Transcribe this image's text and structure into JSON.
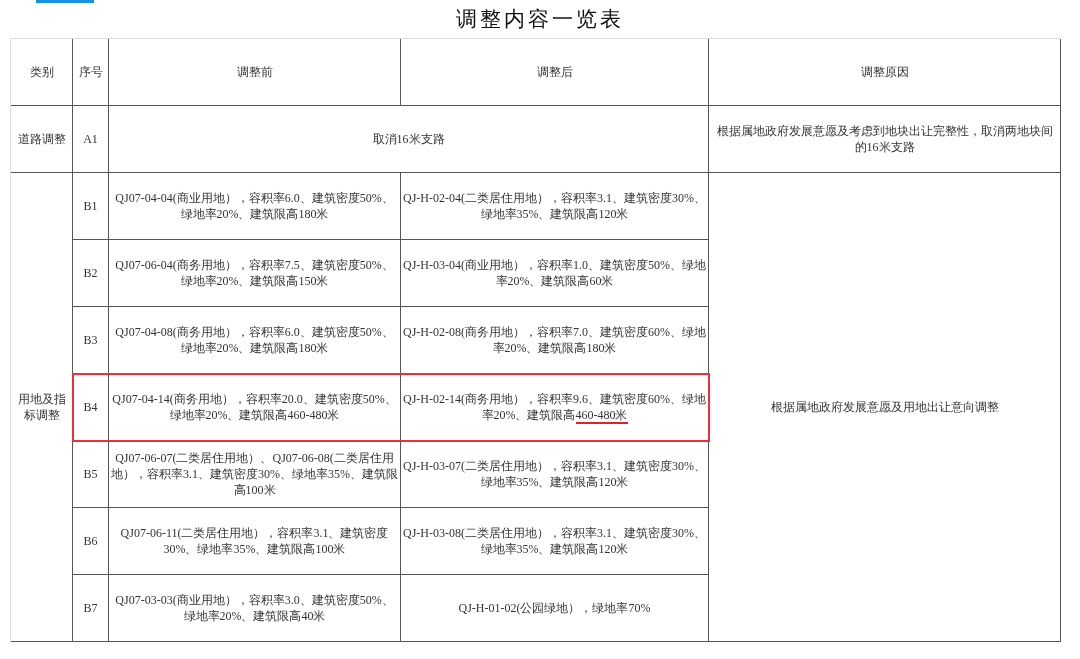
{
  "title": "调整内容一览表",
  "columns": [
    "类别",
    "序号",
    "调整前",
    "调整后",
    "调整原因"
  ],
  "groups": [
    {
      "category": "道路调整",
      "reason": "根据属地政府发展意愿及考虑到地块出让完整性，取消两地块间的16米支路",
      "rows": [
        {
          "kind": "merged",
          "no": "A1",
          "change": "取消16米支路",
          "highlighted": false
        }
      ]
    },
    {
      "category": "用地及指标调整",
      "reason": "根据属地政府发展意愿及用地出让意向调整",
      "rows": [
        {
          "kind": "split",
          "no": "B1",
          "before": "QJ07-04-04(商业用地），容积率6.0、建筑密度50%、绿地率20%、建筑限高180米",
          "after": "QJ-H-02-04(二类居住用地），容积率3.1、建筑密度30%、绿地率35%、建筑限高120米",
          "highlighted": false
        },
        {
          "kind": "split",
          "no": "B2",
          "before": "QJ07-06-04(商务用地），容积率7.5、建筑密度50%、绿地率20%、建筑限高150米",
          "after": "QJ-H-03-04(商业用地），容积率1.0、建筑密度50%、绿地率20%、建筑限高60米",
          "highlighted": false
        },
        {
          "kind": "split",
          "no": "B3",
          "before": "QJ07-04-08(商务用地），容积率6.0、建筑密度50%、绿地率20%、建筑限高180米",
          "after": "QJ-H-02-08(商务用地），容积率7.0、建筑密度60%、绿地率20%、建筑限高180米",
          "highlighted": false
        },
        {
          "kind": "split",
          "no": "B4",
          "before": "QJ07-04-14(商务用地），容积率20.0、建筑密度50%、绿地率20%、建筑限高460-480米",
          "after": "QJ-H-02-14(商务用地），容积率9.6、建筑密度60%、绿地率20%、建筑限高",
          "after_underlined": "460-480米",
          "highlighted": true
        },
        {
          "kind": "split",
          "no": "B5",
          "before": "QJ07-06-07(二类居住用地）、QJ07-06-08(二类居住用地），容积率3.1、建筑密度30%、绿地率35%、建筑限高100米",
          "after": "QJ-H-03-07(二类居住用地），容积率3.1、建筑密度30%、绿地率35%、建筑限高120米",
          "highlighted": false
        },
        {
          "kind": "split",
          "no": "B6",
          "before": "QJ07-06-11(二类居住用地），容积率3.1、建筑密度30%、绿地率35%、建筑限高100米",
          "after": "QJ-H-03-08(二类居住用地），容积率3.1、建筑密度30%、绿地率35%、建筑限高120米",
          "highlighted": false
        },
        {
          "kind": "split",
          "no": "B7",
          "before": "QJ07-03-03(商业用地），容积率3.0、建筑密度50%、绿地率20%、建筑限高40米",
          "after": "QJ-H-01-02(公园绿地），绿地率70%",
          "highlighted": false
        }
      ]
    }
  ]
}
